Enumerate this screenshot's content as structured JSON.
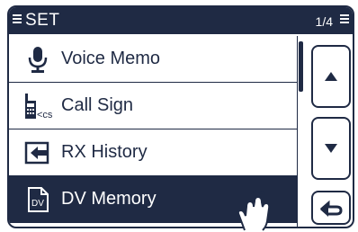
{
  "header": {
    "title": "SET",
    "page": "1/4"
  },
  "menu": {
    "items": [
      {
        "label": "Voice Memo",
        "icon": "microphone-icon"
      },
      {
        "label": "Call Sign",
        "icon": "call-sign-icon",
        "icon_text": "<cs"
      },
      {
        "label": "RX History",
        "icon": "rx-history-icon"
      },
      {
        "label": "DV Memory",
        "icon": "dv-memory-icon",
        "icon_text": "DV",
        "selected": true
      }
    ]
  },
  "buttons": {
    "up": "scroll-up",
    "down": "scroll-down",
    "back": "back"
  },
  "colors": {
    "dark": "#1f2a44",
    "light": "#ffffff"
  }
}
